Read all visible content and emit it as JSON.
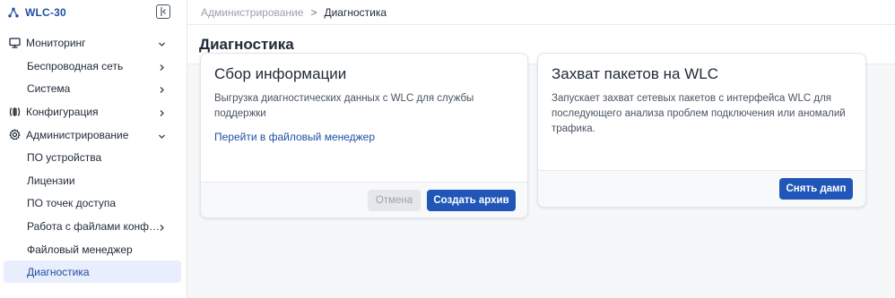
{
  "app": {
    "name": "WLC-30"
  },
  "breadcrumb": {
    "parent": "Администрирование",
    "separator": ">",
    "current": "Диагностика"
  },
  "page": {
    "title": "Диагностика"
  },
  "sidebar": {
    "items": [
      {
        "label": "Мониторинг",
        "icon": "monitor-icon",
        "chevron": "down"
      },
      {
        "label": "Беспроводная сеть",
        "chevron": "right"
      },
      {
        "label": "Система",
        "chevron": "right"
      },
      {
        "label": "Конфигурация",
        "icon": "configuration-icon",
        "chevron": "right"
      },
      {
        "label": "Администрирование",
        "icon": "gear-icon",
        "chevron": "down"
      },
      {
        "label": "ПО устройства"
      },
      {
        "label": "Лицензии"
      },
      {
        "label": "ПО точек доступа"
      },
      {
        "label": "Работа с файлами конф…",
        "chevron": "right"
      },
      {
        "label": "Файловый менеджер"
      },
      {
        "label": "Диагностика",
        "active": true
      }
    ]
  },
  "cards": {
    "collect": {
      "title": "Сбор информации",
      "description": "Выгрузка диагностических данных с WLC для службы поддержки",
      "link": "Перейти в файловый менеджер",
      "cancel_label": "Отмена",
      "create_label": "Создать архив"
    },
    "capture": {
      "title": "Захват пакетов на WLC",
      "description": "Запускает захват сетевых пакетов с интерфейса WLC для последующего анализа проблем подключения или аномалий трафика.",
      "dump_label": "Снять дамп"
    }
  },
  "colors": {
    "accent": "#1f56b8",
    "active_bg": "#e8eefb",
    "brand_text": "#1f4fa3"
  }
}
